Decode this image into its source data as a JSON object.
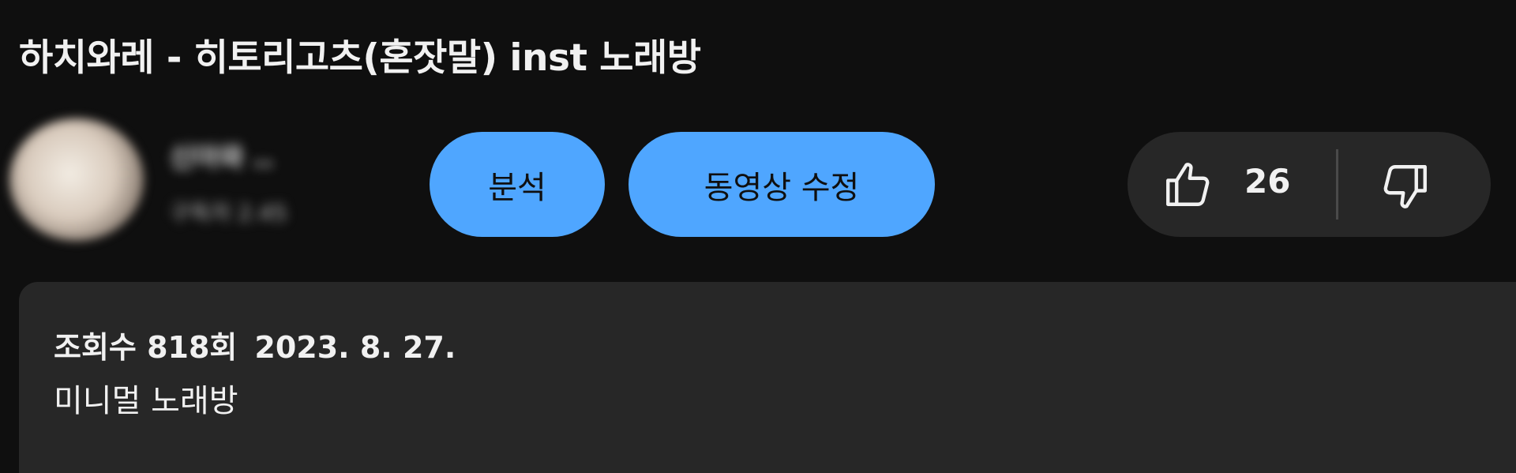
{
  "video": {
    "title": "하치와레 - 히토리고츠(혼잣말) inst 노래방"
  },
  "channel": {
    "name": "신아와 ..",
    "subscribers": "구독자 2.45"
  },
  "actions": {
    "analytics_label": "분석",
    "edit_video_label": "동영상 수정"
  },
  "rating": {
    "like_count": "26",
    "like_icon": "thumbs-up-icon",
    "dislike_icon": "thumbs-down-icon"
  },
  "description": {
    "views": "조회수 818회",
    "date": "2023. 8. 27.",
    "text": "미니멀 노래방"
  },
  "colors": {
    "background": "#0f0f0f",
    "accent_button": "#4fa6ff",
    "surface": "#272727",
    "text": "#f1f1f1"
  }
}
